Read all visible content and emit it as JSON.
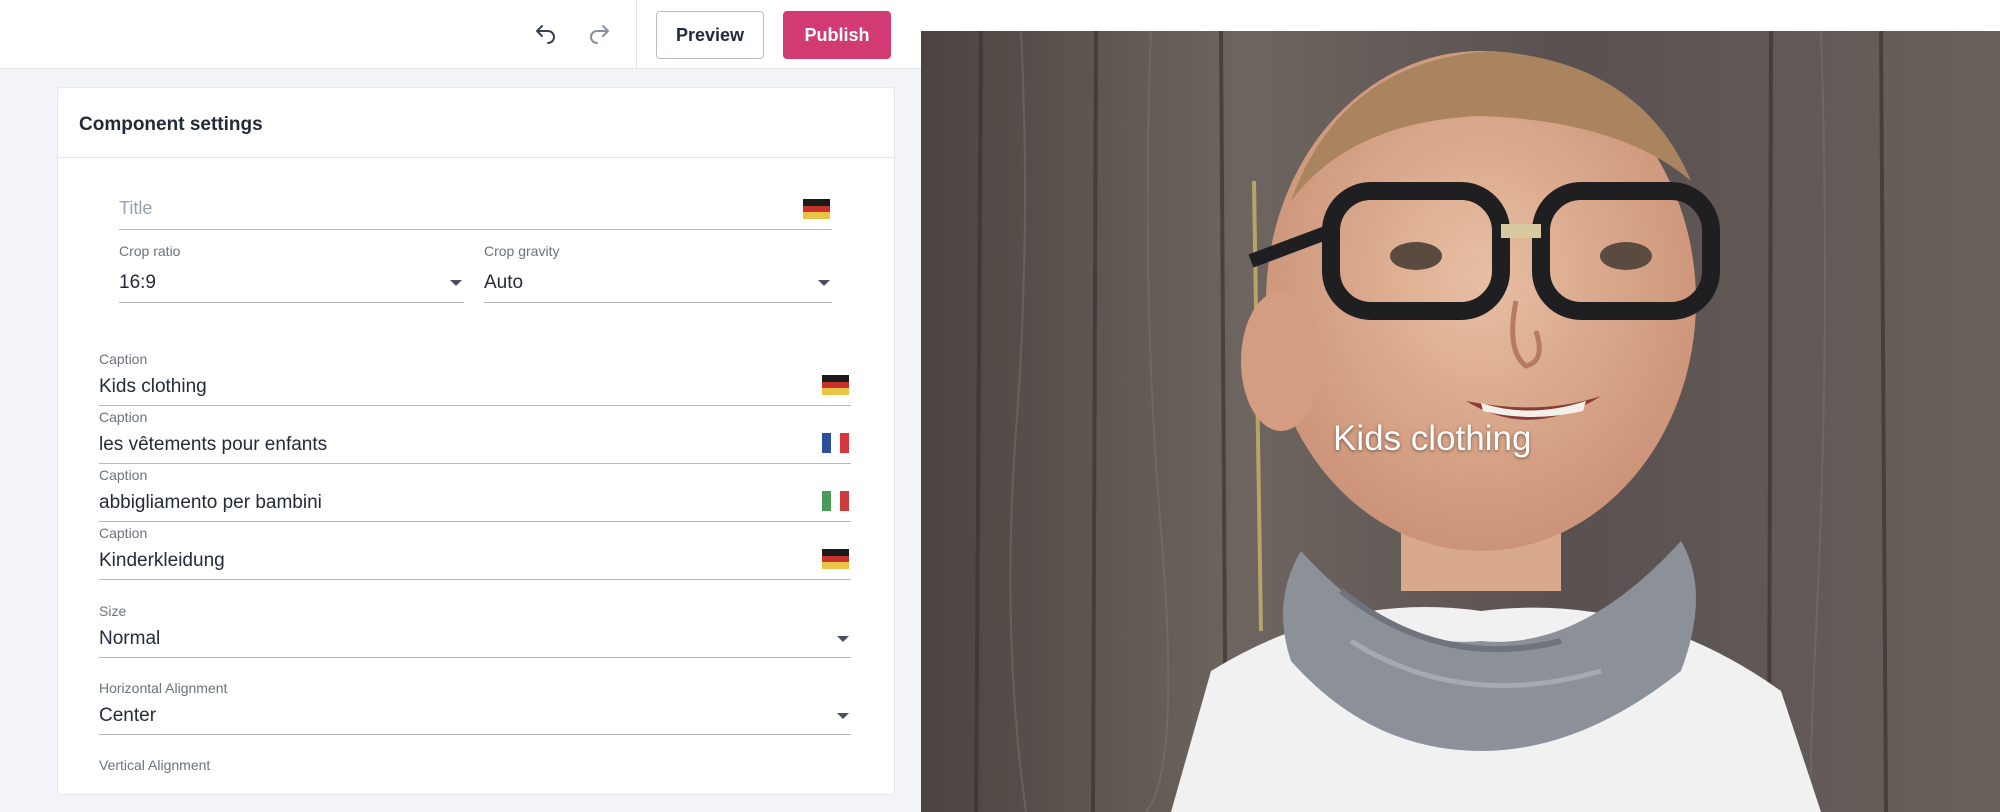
{
  "toolbar": {
    "undo_icon": "undo-icon",
    "redo_icon": "redo-icon",
    "preview_label": "Preview",
    "publish_label": "Publish",
    "publish_color": "#d23a74"
  },
  "panel": {
    "title": "Component settings",
    "title_field": {
      "placeholder": "Title",
      "flag": "de"
    },
    "crop_ratio": {
      "label": "Crop ratio",
      "value": "16:9"
    },
    "crop_gravity": {
      "label": "Crop gravity",
      "value": "Auto"
    },
    "captions": [
      {
        "label": "Caption",
        "value": "Kids clothing",
        "flag": "de"
      },
      {
        "label": "Caption",
        "value": "les vêtements pour enfants",
        "flag": "fr"
      },
      {
        "label": "Caption",
        "value": "abbigliamento per bambini",
        "flag": "it"
      },
      {
        "label": "Caption",
        "value": "Kinderkleidung",
        "flag": "de"
      }
    ],
    "size": {
      "label": "Size",
      "value": "Normal"
    },
    "horizontal_alignment": {
      "label": "Horizontal Alignment",
      "value": "Center"
    },
    "vertical_alignment": {
      "label": "Vertical Alignment"
    }
  },
  "preview": {
    "caption": "Kids clothing"
  }
}
